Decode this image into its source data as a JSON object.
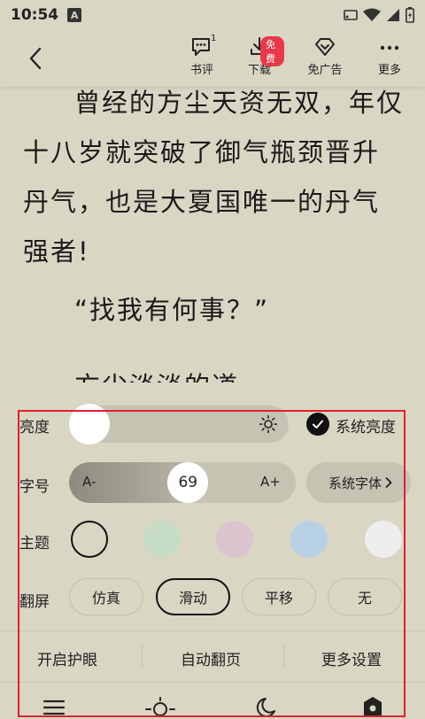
{
  "status": {
    "time": "10:54",
    "notif_letter": "A"
  },
  "toolbar": {
    "comments": {
      "label": "书评",
      "count": "1"
    },
    "download": {
      "label": "下载",
      "badge": "免费"
    },
    "no_ads": {
      "label": "免广告"
    },
    "more": {
      "label": "更多"
    }
  },
  "reading": {
    "paragraphs": [
      "曾经的方尘天资无双，年仅十八岁就突破了御气瓶颈晋升丹气，也是大夏国唯一的丹气强者!",
      "“找我有何事？”",
      "方尘淡淡的道"
    ]
  },
  "settings": {
    "brightness": {
      "label": "亮度",
      "level": 0.0,
      "system_label": "系统亮度",
      "system_checked": true
    },
    "font_size": {
      "label": "字号",
      "minus": "A-",
      "plus": "A+",
      "value": "69",
      "level": 0.53,
      "family_button": "系统字体"
    },
    "theme": {
      "label": "主题",
      "colors": [
        "#d9d6c4",
        "#c6dcc4",
        "#dcc4cf",
        "#b9d1e6",
        "#eeeeee"
      ],
      "selected_index": 0
    },
    "page_flip": {
      "label": "翻屏",
      "options": [
        "仿真",
        "滑动",
        "平移",
        "无"
      ],
      "selected_index": 1
    }
  },
  "bottom_links": [
    "开启护眼",
    "自动翻页",
    "更多设置"
  ],
  "accent": {
    "highlight_border": "#e0202e",
    "free_badge": "#e8384a"
  }
}
